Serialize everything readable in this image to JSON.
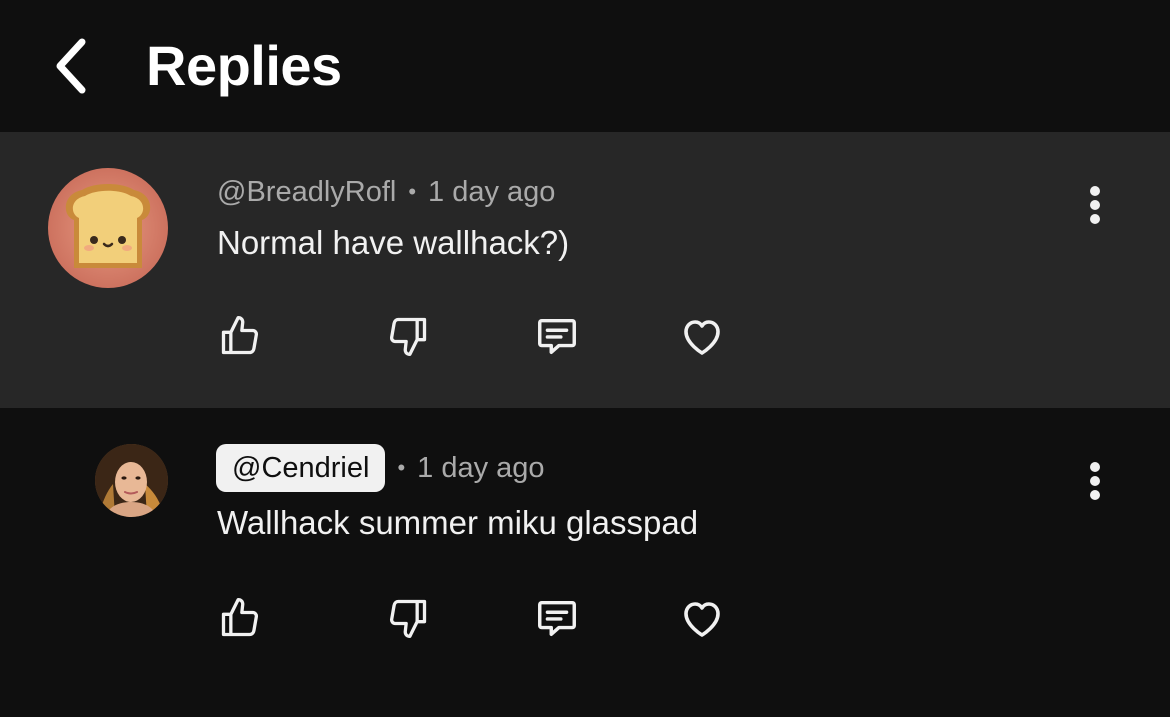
{
  "header": {
    "title": "Replies",
    "back_icon": "chevron-left-icon"
  },
  "comments": [
    {
      "handle": "@BreadlyRofl",
      "separator": "•",
      "time": "1 day ago",
      "text": "Normal have wallhack?)",
      "avatar": "toast-avatar",
      "is_highlighted": true
    },
    {
      "handle": "@Cendriel",
      "separator": "•",
      "time": "1 day ago",
      "text": "Wallhack summer miku glasspad",
      "avatar": "user-photo-avatar",
      "handle_badge": true
    }
  ],
  "icons": {
    "like": "thumbs-up-icon",
    "dislike": "thumbs-down-icon",
    "reply": "comment-icon",
    "heart": "heart-icon",
    "more": "more-vertical-icon"
  },
  "colors": {
    "background": "#0f0f0f",
    "highlight": "#272727",
    "text": "#f1f1f1",
    "secondary_text": "#aaaaaa",
    "badge_bg": "#f1f1f1"
  }
}
